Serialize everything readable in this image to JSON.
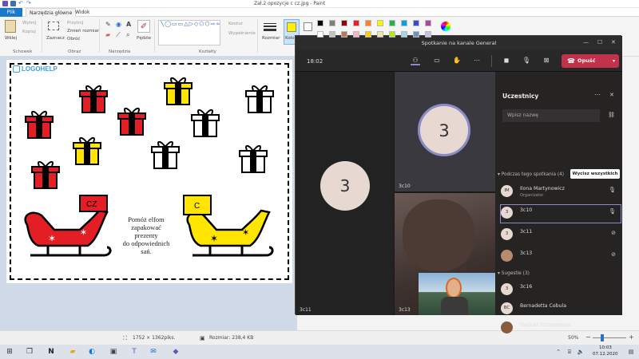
{
  "paint": {
    "title": "Zał.2 opozycje c cz.jpg - Paint",
    "tabs": {
      "file": "Plik",
      "home": "Narzędzia główne",
      "view": "Widok"
    },
    "ribbon": {
      "paste": "Wklej",
      "cut": "Wytnij",
      "copy": "Kopiuj",
      "group_clipboard": "Schowek",
      "select": "Zaznacz",
      "crop": "Przytnij",
      "resize": "Zmień rozmiar",
      "rotate": "Obróć",
      "group_image": "Obraz",
      "group_tools": "Narzędzia",
      "brushes": "Pędzle",
      "outline": "Kontur",
      "fill": "Wypełnienie",
      "group_shapes": "Kształty",
      "size": "Rozmiar",
      "color1": "Kolor"
    },
    "palette": [
      "#000000",
      "#7f7f7f",
      "#880015",
      "#ed1c24",
      "#ff7f27",
      "#fff200",
      "#22b14c",
      "#00a2e8",
      "#3f48cc",
      "#a349a4",
      "#ffffff",
      "#c3c3c3",
      "#b97a57",
      "#ffaec9",
      "#ffc90e",
      "#efe4b0",
      "#b5e61d",
      "#99d9ea",
      "#7092be",
      "#c8bfe7"
    ],
    "drawing": {
      "logo": "LOGOHELP",
      "label_cz": "CZ",
      "label_c": "C",
      "instruction": [
        "Pomóż elfom",
        "zapakować",
        "prezenty",
        "do odpowiednich",
        "sań."
      ]
    },
    "status": {
      "dimensions": "1752 × 1362piks.",
      "filesize": "Rozmiar: 238,4 KB",
      "zoom": "50%"
    }
  },
  "teams": {
    "title": "Spotkanie na kanale General",
    "timer": "18:02",
    "leave": "Opuść",
    "tiles": [
      {
        "name": "3c11",
        "avatar": "3"
      },
      {
        "name": "3c10",
        "avatar": "3"
      },
      {
        "name": "3c13",
        "avatar": ""
      }
    ],
    "panel": {
      "title": "Uczestnicy",
      "search_placeholder": "Wpisz nazwę",
      "in_meeting": "Podczas tego spotkania (4)",
      "mute_all": "Wycisz wszystkich",
      "participants": [
        {
          "avatar": "IM",
          "name": "Ilona Martynowicz",
          "role": "Organizator"
        },
        {
          "avatar": "3",
          "name": "3c10",
          "role": ""
        },
        {
          "avatar": "3",
          "name": "3c11",
          "role": ""
        },
        {
          "avatar": "",
          "name": "3c13",
          "role": ""
        }
      ],
      "suggestions": "Sugestie (3)",
      "suggested": [
        {
          "avatar": "3",
          "name": "3c16"
        },
        {
          "avatar": "BC",
          "name": "Bernadetta Cebula"
        },
        {
          "avatar": "",
          "name": "Dariusz Szczembara"
        }
      ]
    }
  },
  "taskbar": {
    "time": "10:03",
    "date": "07.12.2020"
  }
}
